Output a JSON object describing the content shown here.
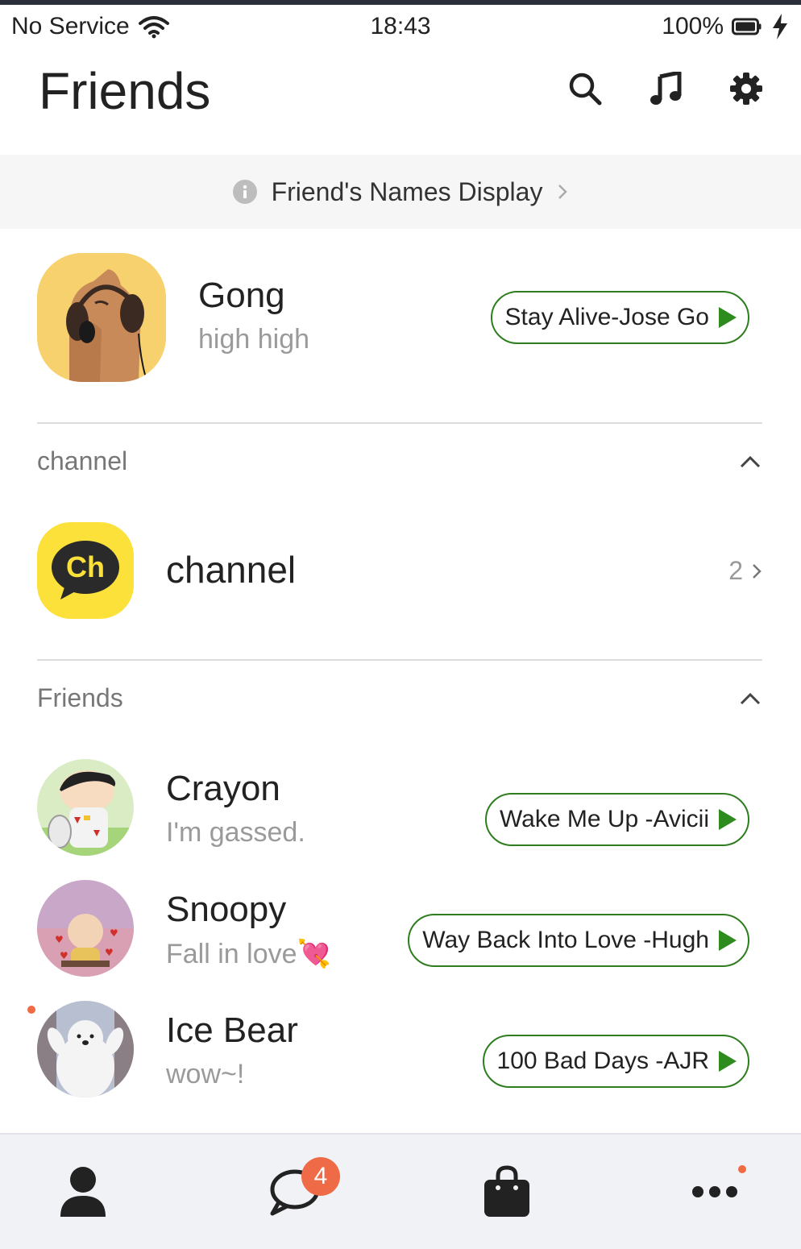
{
  "status_bar": {
    "carrier": "No Service",
    "time": "18:43",
    "battery": "100%"
  },
  "header": {
    "title": "Friends",
    "icons": [
      "search-icon",
      "music-note-icon",
      "gear-icon"
    ]
  },
  "names_banner": {
    "label": "Friend's Names Display"
  },
  "my_profile": {
    "name": "Gong",
    "status": "high high",
    "music": "Stay Alive-Jose Go"
  },
  "channel_section": {
    "label": "channel",
    "item": {
      "name": "channel",
      "count": "2"
    }
  },
  "friends_section": {
    "label": "Friends",
    "items": [
      {
        "name": "Crayon",
        "status": "I'm gassed.",
        "music": "Wake Me Up -Avicii"
      },
      {
        "name": "Snoopy",
        "status": "Fall in love💘",
        "music": "Way Back Into Love -Hugh"
      },
      {
        "name": "Ice Bear",
        "status": "wow~!",
        "music": "100 Bad Days -AJR"
      }
    ]
  },
  "bottom_nav": {
    "items": [
      "person-icon",
      "chat-bubble-icon",
      "shopping-bag-icon",
      "more-icon"
    ],
    "chat_badge": "4"
  },
  "colors": {
    "accent_green": "#2e7d1e",
    "badge_red": "#ef6a46",
    "channel_yellow": "#fbe13a"
  }
}
